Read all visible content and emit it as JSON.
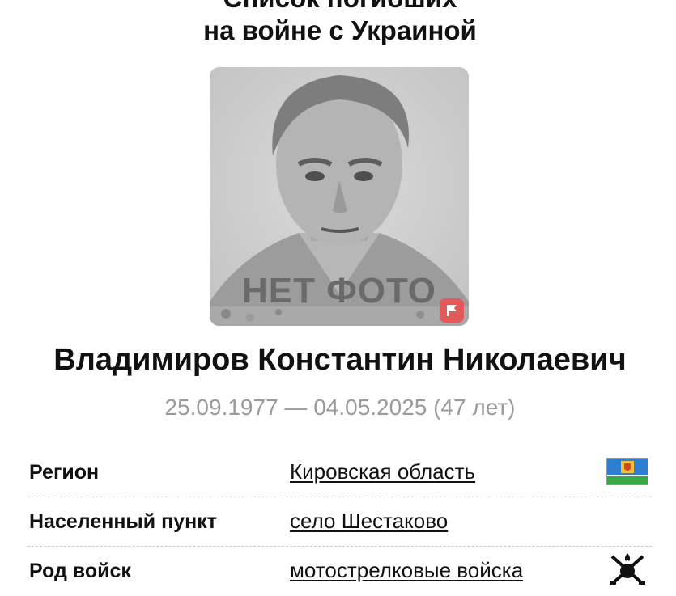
{
  "header": {
    "title_line1": "Список погибших",
    "title_line2": "на войне с Украиной"
  },
  "photo": {
    "placeholder_text": "НЕТ ФОТО",
    "flag_icon": "report-flag-icon",
    "flag_color": "#e35a5a"
  },
  "person": {
    "name": "Владимиров Константин Николаевич",
    "dates": "25.09.1977 — 04.05.2025 (47 лет)"
  },
  "details": [
    {
      "label": "Регион",
      "value": "Кировская область",
      "icon": "kirov-region-flag-icon"
    },
    {
      "label": "Населенный пункт",
      "value": "село Шестаково",
      "icon": ""
    },
    {
      "label": "Род войск",
      "value": "мотострелковые войска",
      "icon": "motorized-rifle-troops-emblem-icon"
    }
  ]
}
